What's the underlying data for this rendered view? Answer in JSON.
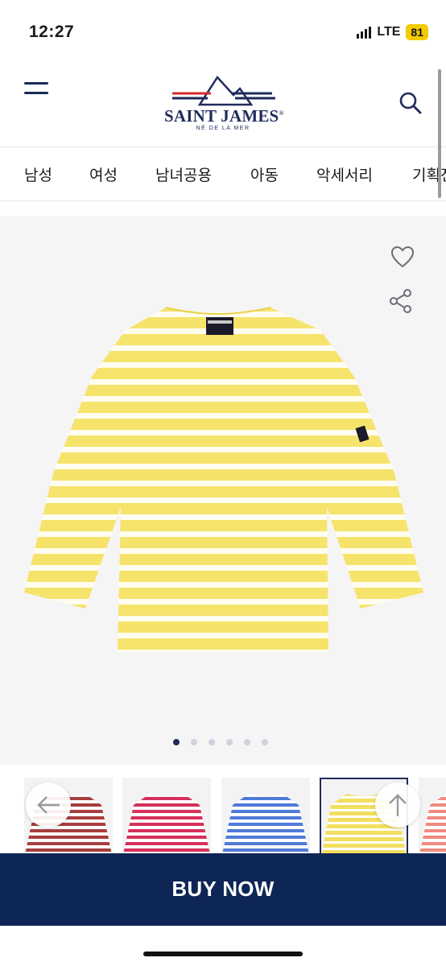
{
  "status_bar": {
    "time": "12:27",
    "network": "LTE",
    "battery": "81"
  },
  "header": {
    "logo_text": "SAINT JAMES",
    "logo_registered": "®",
    "logo_tagline": "NÉ DE LA MER",
    "menu_icon": "hamburger-menu-icon",
    "search_icon": "search-icon"
  },
  "categories": [
    "남성",
    "여성",
    "남녀공용",
    "아동",
    "악세서리",
    "기획전"
  ],
  "product": {
    "color": "yellow",
    "stripe_color": "#f6e36b",
    "base_color": "#fffdf0",
    "actions": {
      "wishlist_icon": "heart-icon",
      "share_icon": "share-icon"
    },
    "image_pagination": {
      "total": 6,
      "current": 1
    }
  },
  "thumbnails": [
    {
      "color": "#a73e3e",
      "selected": false
    },
    {
      "color": "#d6305a",
      "selected": false
    },
    {
      "color": "#4f7bd8",
      "selected": false
    },
    {
      "color": "#f3df5f",
      "selected": true
    },
    {
      "color": "#f08a80",
      "selected": false
    }
  ],
  "carousel_controls": {
    "prev_icon": "arrow-left-icon",
    "scroll_top_icon": "arrow-up-icon"
  },
  "cta": {
    "buy_now_label": "BUY NOW"
  },
  "colors": {
    "brand_navy": "#0e2656",
    "logo_red": "#d42a2a",
    "battery": "#f2cb00"
  }
}
